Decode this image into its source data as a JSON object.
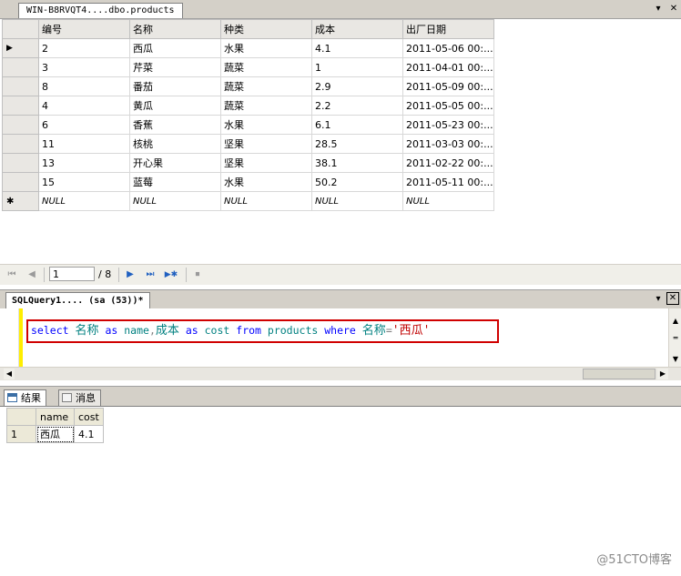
{
  "table_tab": {
    "title": "WIN-B8RVQT4....dbo.products",
    "pin": "▾",
    "close": "✕"
  },
  "grid": {
    "columns": [
      "编号",
      "名称",
      "种类",
      "成本",
      "出厂日期"
    ],
    "rows": [
      [
        "2",
        "西瓜",
        "水果",
        "4.1",
        "2011-05-06 00:..."
      ],
      [
        "3",
        "芹菜",
        "蔬菜",
        "1",
        "2011-04-01 00:..."
      ],
      [
        "8",
        "番茄",
        "蔬菜",
        "2.9",
        "2011-05-09 00:..."
      ],
      [
        "4",
        "黄瓜",
        "蔬菜",
        "2.2",
        "2011-05-05 00:..."
      ],
      [
        "6",
        "香蕉",
        "水果",
        "6.1",
        "2011-05-23 00:..."
      ],
      [
        "11",
        "核桃",
        "坚果",
        "28.5",
        "2011-03-03 00:..."
      ],
      [
        "13",
        "开心果",
        "坚果",
        "38.1",
        "2011-02-22 00:..."
      ],
      [
        "15",
        "蓝莓",
        "水果",
        "50.2",
        "2011-05-11 00:..."
      ]
    ],
    "new_row": [
      "NULL",
      "NULL",
      "NULL",
      "NULL",
      "NULL"
    ],
    "current_row_marker": "▶",
    "new_row_marker": "✱"
  },
  "navigator": {
    "current_record": "1",
    "total": "/ 8",
    "icons": {
      "first": "⏮",
      "prev": "◀",
      "next": "▶",
      "last": "⏭",
      "new": "▶✱",
      "stop": "⏹"
    }
  },
  "query_tab": {
    "title": "SQLQuery1....  (sa (53))*",
    "pin": "▾",
    "close": "✕"
  },
  "sql": {
    "kw_select": "select",
    "col1": "名称",
    "kw_as1": "as",
    "alias1": "name",
    "comma": ",",
    "col2": "成本",
    "kw_as2": "as",
    "alias2": "cost",
    "kw_from": "from",
    "table": "products",
    "kw_where": "where",
    "col3": "名称",
    "eq": "=",
    "literal": "'西瓜'"
  },
  "results_tabs": {
    "results": "结果",
    "messages": "消息"
  },
  "results_grid": {
    "columns": [
      "name",
      "cost"
    ],
    "rows": [
      [
        "1",
        "西瓜",
        "4.1"
      ]
    ]
  },
  "watermark": "@51CTO博客"
}
